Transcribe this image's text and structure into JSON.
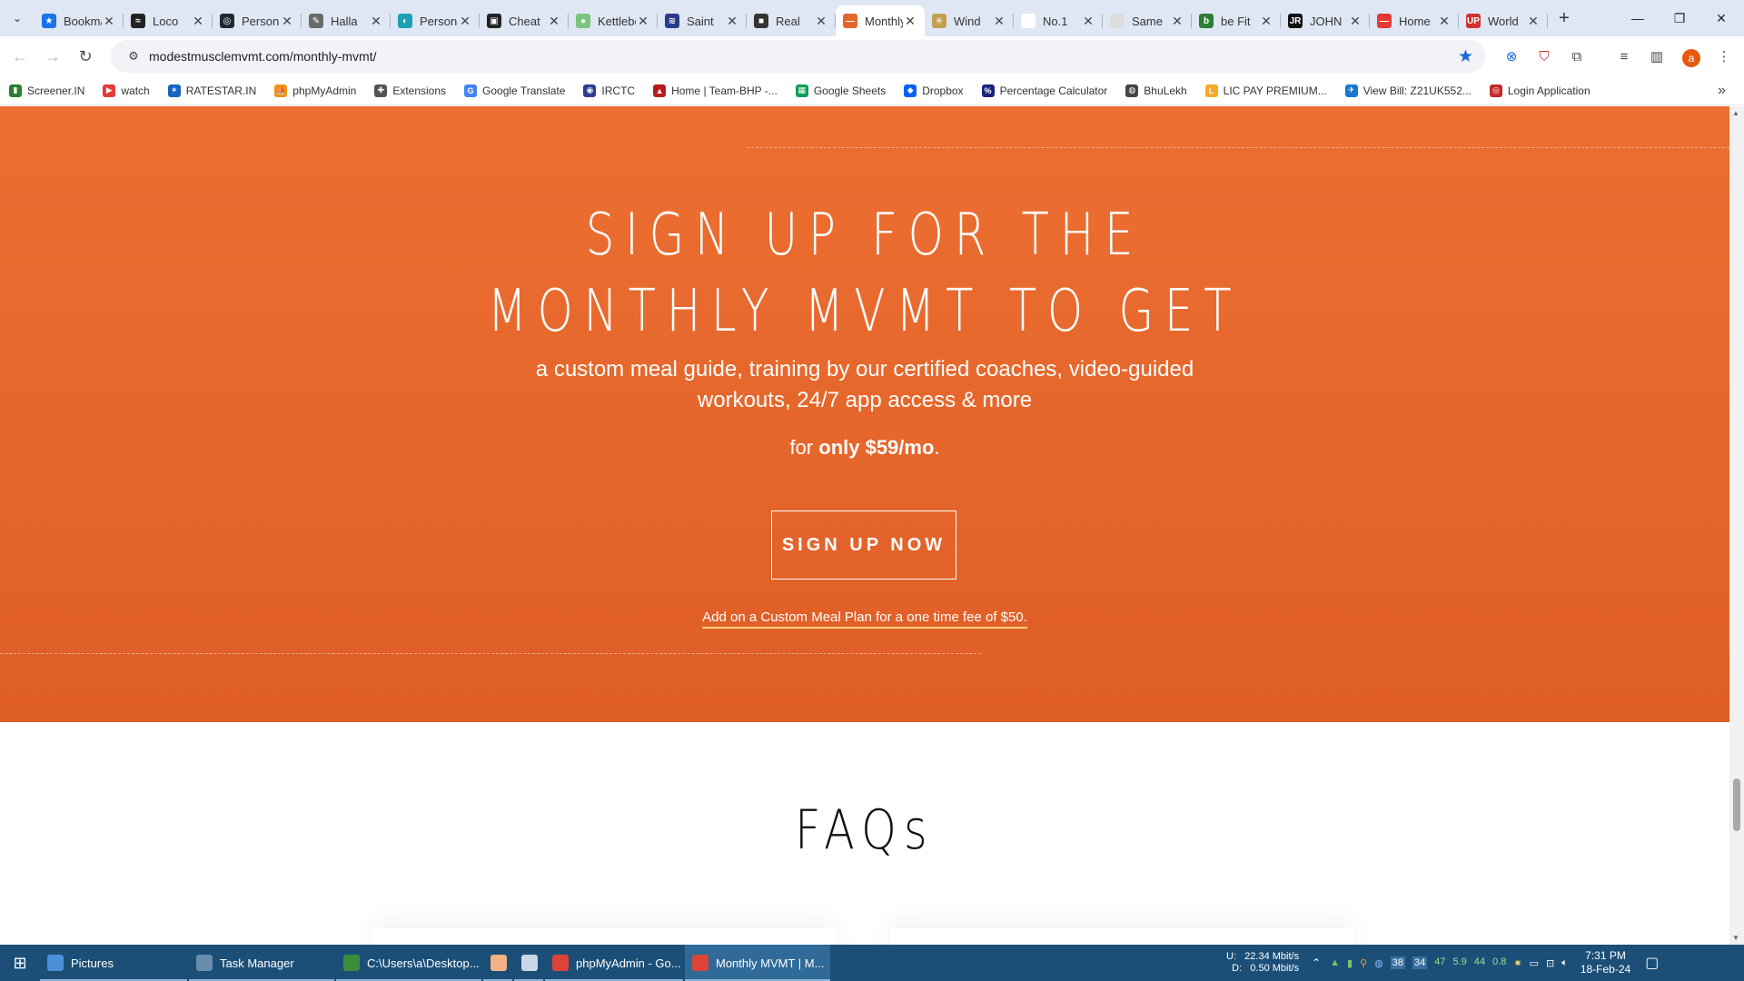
{
  "browser": {
    "tabs": [
      {
        "title": "Bookmarks",
        "color": "#1a73e8",
        "glyph": "★",
        "active": false
      },
      {
        "title": "Loco",
        "color": "#222222",
        "glyph": "≈",
        "active": false
      },
      {
        "title": "Personal",
        "color": "#1c2b33",
        "glyph": "◎",
        "active": false
      },
      {
        "title": "Halla",
        "color": "#6b6b6b",
        "glyph": "✎",
        "active": false
      },
      {
        "title": "Personal",
        "color": "#1aa1b5",
        "glyph": "◐",
        "active": false
      },
      {
        "title": "Cheat",
        "color": "#222222",
        "glyph": "▣",
        "active": false
      },
      {
        "title": "Kettlebell",
        "color": "#7ac47e",
        "glyph": "●",
        "active": false
      },
      {
        "title": "Saint",
        "color": "#2a3a8c",
        "glyph": "≋",
        "active": false
      },
      {
        "title": "Real",
        "color": "#333333",
        "glyph": "■",
        "active": false
      },
      {
        "title": "Monthly MVMT",
        "color": "#e5652b",
        "glyph": "—",
        "active": true
      },
      {
        "title": "Wind",
        "color": "#c5a050",
        "glyph": "✳",
        "active": false
      },
      {
        "title": "No.1",
        "color": "#ffffff",
        "glyph": "",
        "active": false
      },
      {
        "title": "Same",
        "color": "#dddddd",
        "glyph": "",
        "active": false
      },
      {
        "title": "be Fit",
        "color": "#2e7d32",
        "glyph": "b",
        "active": false
      },
      {
        "title": "JOHN",
        "color": "#111111",
        "glyph": "JR",
        "active": false
      },
      {
        "title": "Home",
        "color": "#e53935",
        "glyph": "—",
        "active": false
      },
      {
        "title": "World",
        "color": "#d32f2f",
        "glyph": "UP",
        "active": false
      }
    ],
    "url": "modestmusclemvmt.com/monthly-mvmt/",
    "avatar_letter": "a",
    "bookmarks": [
      {
        "label": "Screener.IN",
        "color": "#2e7d32",
        "glyph": "▮"
      },
      {
        "label": "watch",
        "color": "#e53935",
        "glyph": "▶"
      },
      {
        "label": "RATESTAR.IN",
        "color": "#1565c0",
        "glyph": "✶"
      },
      {
        "label": "phpMyAdmin",
        "color": "#f29111",
        "glyph": "⛵"
      },
      {
        "label": "Extensions",
        "color": "#555555",
        "glyph": "✚"
      },
      {
        "label": "Google Translate",
        "color": "#4285f4",
        "glyph": "G"
      },
      {
        "label": "IRCTC",
        "color": "#2c3e91",
        "glyph": "◉"
      },
      {
        "label": "Home | Team-BHP -...",
        "color": "#b71c1c",
        "glyph": "▲"
      },
      {
        "label": "Google Sheets",
        "color": "#0f9d58",
        "glyph": "▦"
      },
      {
        "label": "Dropbox",
        "color": "#0061fe",
        "glyph": "◆"
      },
      {
        "label": "Percentage Calculator",
        "color": "#1a237e",
        "glyph": "%"
      },
      {
        "label": "BhuLekh",
        "color": "#444444",
        "glyph": "◍"
      },
      {
        "label": "LIC PAY PREMIUM...",
        "color": "#f9a825",
        "glyph": "L"
      },
      {
        "label": "View Bill: Z21UK552...",
        "color": "#1976d2",
        "glyph": "✈"
      },
      {
        "label": "Login Application",
        "color": "#c62828",
        "glyph": "◎"
      }
    ]
  },
  "page": {
    "headline_line1": "SIGN UP FOR THE",
    "headline_line2": "MONTHLY MVMT TO GET",
    "subtext": "a custom meal guide, training by our certified coaches, video-guided workouts, 24/7 app access & more",
    "price_prefix": "for ",
    "price_bold": "only $59/mo",
    "price_suffix": ".",
    "cta_label": "SIGN UP NOW",
    "addon_link": "Add on a Custom Meal Plan for a one time fee of $50.",
    "faq_title": "FAQs",
    "colors": {
      "accent": "#e5652b"
    }
  },
  "taskbar": {
    "items": [
      {
        "label": "Pictures",
        "icon": "folder-icon",
        "color": "#4a90d9",
        "active": false
      },
      {
        "label": "Task Manager",
        "icon": "task-manager-icon",
        "color": "#6a8caf",
        "active": false
      },
      {
        "label": "C:\\Users\\a\\Desktop...",
        "icon": "notepad-icon",
        "color": "#3b8d3b",
        "active": false
      },
      {
        "label": "",
        "icon": "app-icon",
        "color": "#f4b183",
        "active": false
      },
      {
        "label": "",
        "icon": "document-icon",
        "color": "#c9d7e8",
        "active": false
      },
      {
        "label": "phpMyAdmin - Go...",
        "icon": "chrome-icon",
        "color": "#db4437",
        "active": false
      },
      {
        "label": "Monthly MVMT | M...",
        "icon": "chrome-icon",
        "color": "#db4437",
        "active": true
      }
    ],
    "net_up": "22.34 Mbit/s",
    "net_down": "0.50 Mbit/s",
    "net_up_label": "U:",
    "net_down_label": "D:",
    "tray_numbers": [
      "38",
      "34",
      "47",
      "5.9",
      "44",
      "0.8"
    ],
    "time": "7:31 PM",
    "date": "18-Feb-24"
  }
}
